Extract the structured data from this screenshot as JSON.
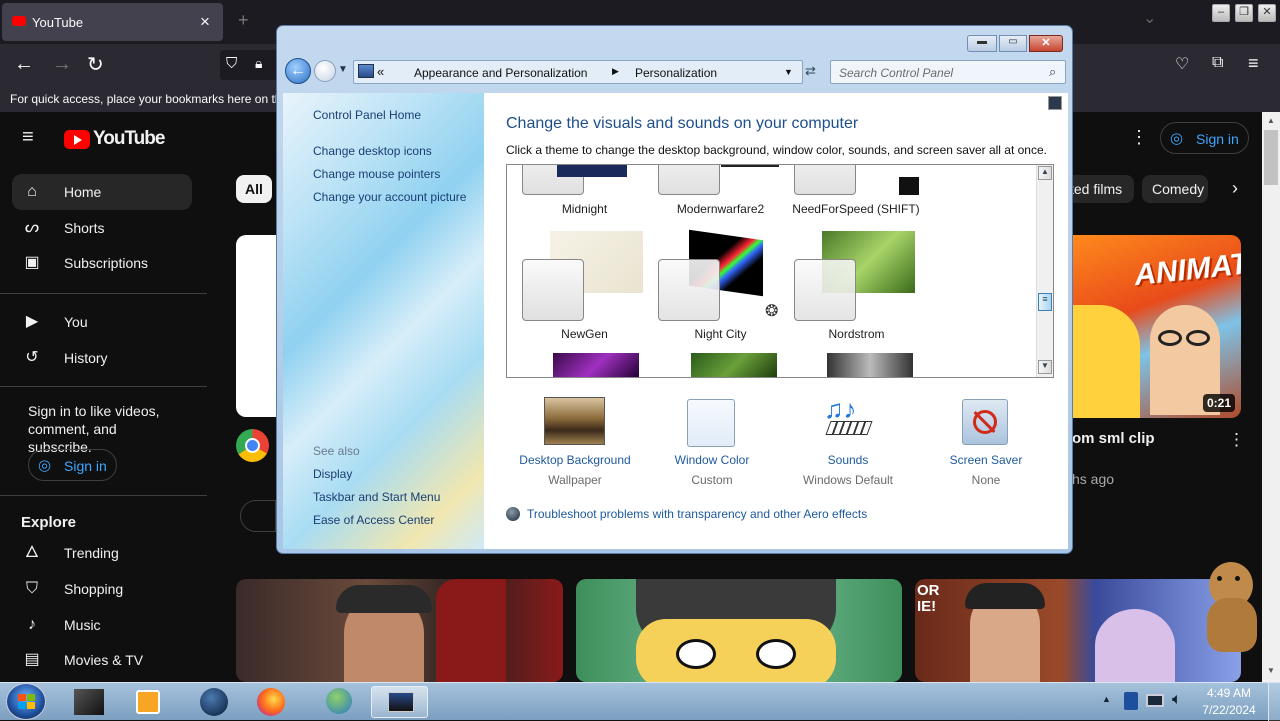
{
  "browser": {
    "tab_title": "YouTube",
    "tab_close": "×",
    "new_tab": "+",
    "bookmarks_hint": "For quick access, place your bookmarks here on the",
    "window_buttons": {
      "minimize": "–",
      "restore": "❐",
      "close": "✕"
    }
  },
  "youtube": {
    "logo_text": "YouTube",
    "sign_in": "Sign in",
    "sidebar": {
      "primary": [
        {
          "label": "Home",
          "icon": "home-icon"
        },
        {
          "label": "Shorts",
          "icon": "shorts-icon"
        },
        {
          "label": "Subscriptions",
          "icon": "subscriptions-icon"
        }
      ],
      "secondary": [
        {
          "label": "You",
          "icon": "you-icon"
        },
        {
          "label": "History",
          "icon": "history-icon"
        }
      ],
      "signin_prompt": "Sign in to like videos, comment, and subscribe.",
      "signin_button": "Sign in",
      "explore_heading": "Explore",
      "explore": [
        {
          "label": "Trending"
        },
        {
          "label": "Shopping"
        },
        {
          "label": "Music"
        },
        {
          "label": "Movies & TV"
        }
      ]
    },
    "chips": {
      "all": "All",
      "partial": "ted films",
      "comedy": "Comedy"
    },
    "video": {
      "duration": "0:21",
      "title_partial": "om sml clip",
      "meta_partial": "hs ago",
      "thumb_text": "ANIMATED"
    },
    "shorts_thumb_text": "OR IE!"
  },
  "control_panel": {
    "breadcrumb": [
      "Appearance and Personalization",
      "Personalization"
    ],
    "breadcrumb_prefix": "«",
    "search_placeholder": "Search Control Panel",
    "left_links": [
      "Control Panel Home",
      "Change desktop icons",
      "Change mouse pointers",
      "Change your account picture"
    ],
    "see_also_heading": "See also",
    "see_also": [
      "Display",
      "Taskbar and Start Menu",
      "Ease of Access Center"
    ],
    "heading": "Change the visuals and sounds on your computer",
    "subheading": "Click a theme to change the desktop background, window color, sounds, and screen saver all at once.",
    "themes_row1": [
      "Midnight",
      "Modernwarfare2",
      "NeedForSpeed (SHIFT)"
    ],
    "themes_row2": [
      "NewGen",
      "Night City",
      "Nordstrom"
    ],
    "bottom": [
      {
        "label": "Desktop Background",
        "sub": "Wallpaper"
      },
      {
        "label": "Window Color",
        "sub": "Custom"
      },
      {
        "label": "Sounds",
        "sub": "Windows Default"
      },
      {
        "label": "Screen Saver",
        "sub": "None"
      }
    ],
    "troubleshoot": "Troubleshoot problems with transparency and other Aero effects"
  },
  "taskbar": {
    "time": "4:49 AM",
    "date": "7/22/2024"
  }
}
